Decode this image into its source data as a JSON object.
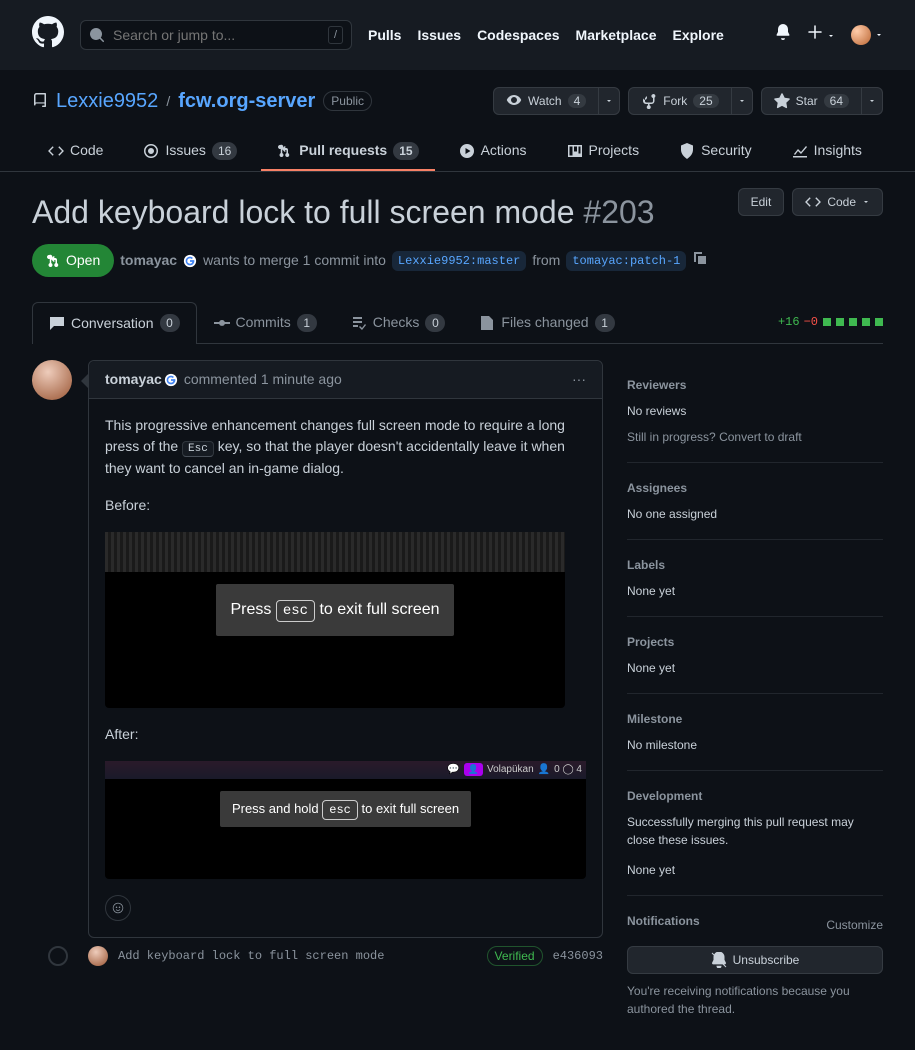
{
  "header": {
    "search_placeholder": "Search or jump to...",
    "nav": {
      "pulls": "Pulls",
      "issues": "Issues",
      "codespaces": "Codespaces",
      "marketplace": "Marketplace",
      "explore": "Explore"
    }
  },
  "repo": {
    "owner": "Lexxie9952",
    "name": "fcw.org-server",
    "visibility": "Public",
    "watch": {
      "label": "Watch",
      "count": "4"
    },
    "fork": {
      "label": "Fork",
      "count": "25"
    },
    "star": {
      "label": "Star",
      "count": "64"
    },
    "tabs": {
      "code": "Code",
      "issues": "Issues",
      "issues_count": "16",
      "pulls": "Pull requests",
      "pulls_count": "15",
      "actions": "Actions",
      "projects": "Projects",
      "security": "Security",
      "insights": "Insights"
    }
  },
  "pr": {
    "title": "Add keyboard lock to full screen mode",
    "number": "#203",
    "edit": "Edit",
    "code_btn": "Code",
    "state": "Open",
    "author": "tomayac",
    "merge_text": {
      "wants": "wants to merge 1 commit into",
      "base": "Lexxie9952:master",
      "from": "from",
      "compare": "tomayac:patch-1"
    },
    "diff": {
      "plus": "+16",
      "minus": "−0"
    },
    "tabs": {
      "conversation": "Conversation",
      "conversation_count": "0",
      "commits": "Commits",
      "commits_count": "1",
      "checks": "Checks",
      "checks_count": "0",
      "files": "Files changed",
      "files_count": "1"
    }
  },
  "comment": {
    "author": "tomayac",
    "time": "commented 1 minute ago",
    "body1": "This progressive enhancement changes full screen mode to require a long press of the ",
    "esc": "Esc",
    "body2": " key, so that the player doesn't accidentally leave it when they want to cancel an in-game dialog.",
    "before_label": "Before:",
    "after_label": "After:",
    "before_toast": {
      "pre": "Press ",
      "key": "esc",
      "post": " to exit full screen"
    },
    "after_toast": {
      "pre": "Press and hold ",
      "key": "esc",
      "post": " to exit full screen"
    },
    "after_bar_text": "Volapükan",
    "after_bar_stats": "0   ◯ 4"
  },
  "commit": {
    "message": "Add keyboard lock to full screen mode",
    "verified": "Verified",
    "sha": "e436093"
  },
  "sidebar": {
    "reviewers": {
      "title": "Reviewers",
      "none": "No reviews",
      "progress": "Still in progress?",
      "convert": "Convert to draft"
    },
    "assignees": {
      "title": "Assignees",
      "none": "No one assigned"
    },
    "labels": {
      "title": "Labels",
      "none": "None yet"
    },
    "projects": {
      "title": "Projects",
      "none": "None yet"
    },
    "milestone": {
      "title": "Milestone",
      "none": "No milestone"
    },
    "development": {
      "title": "Development",
      "msg": "Successfully merging this pull request may close these issues.",
      "none": "None yet"
    },
    "notifications": {
      "title": "Notifications",
      "customize": "Customize",
      "btn": "Unsubscribe",
      "msg": "You're receiving notifications because you authored the thread."
    }
  }
}
